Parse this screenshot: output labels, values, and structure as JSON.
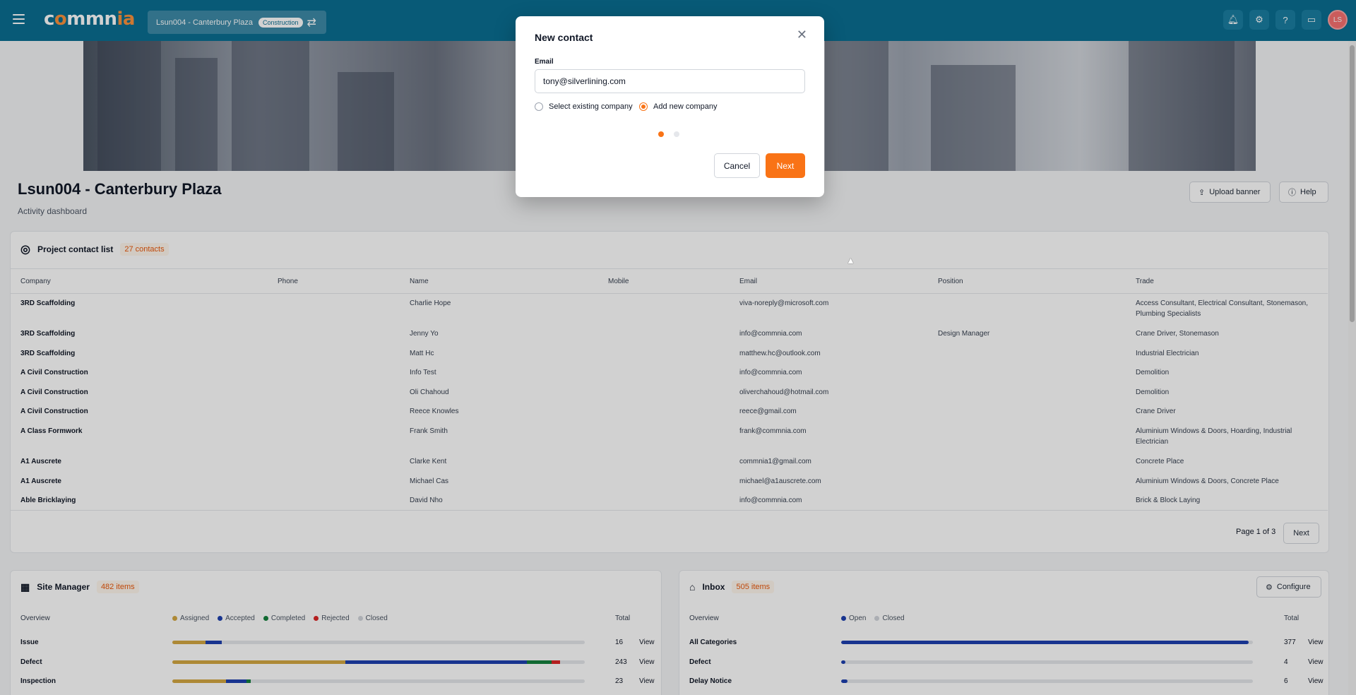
{
  "topbar": {
    "logo": "commnia",
    "project_name": "Lsun004 - Canterbury Plaza",
    "project_badge": "Construction",
    "avatar": "LS",
    "icons": [
      "bell-icon",
      "gear-icon",
      "help-icon",
      "chat-icon"
    ]
  },
  "page": {
    "title": "Lsun004 - Canterbury Plaza",
    "subtitle": "Activity dashboard",
    "upload_banner": "Upload banner",
    "help": "Help"
  },
  "contacts": {
    "title": "Project contact list",
    "count": "27 contacts",
    "headers": [
      "Company",
      "Phone",
      "Name",
      "Mobile",
      "Email",
      "Position",
      "Trade"
    ],
    "rows": [
      {
        "company": "3RD Scaffolding",
        "name": "Charlie Hope",
        "email": "viva-noreply@microsoft.com",
        "position": "",
        "trade": "Access Consultant, Electrical Consultant, Stonemason,",
        "trade2": "Plumbing Specialists"
      },
      {
        "company": "3RD Scaffolding",
        "name": "Jenny Yo",
        "email": "info@commnia.com",
        "position": "Design Manager",
        "trade": "Crane Driver, Stonemason",
        "trade2": ""
      },
      {
        "company": "3RD Scaffolding",
        "name": "Matt Hc",
        "email": "matthew.hc@outlook.com",
        "position": "",
        "trade": "Industrial Electrician",
        "trade2": ""
      },
      {
        "company": "A Civil Construction",
        "name": "Info Test",
        "email": "info@commnia.com",
        "position": "",
        "trade": "Demolition",
        "trade2": ""
      },
      {
        "company": "A Civil Construction",
        "name": "Oli Chahoud",
        "email": "oliverchahoud@hotmail.com",
        "position": "",
        "trade": "Demolition",
        "trade2": ""
      },
      {
        "company": "A Civil Construction",
        "name": "Reece Knowles",
        "email": "reece@gmail.com",
        "position": "",
        "trade": "Crane Driver",
        "trade2": ""
      },
      {
        "company": "A Class Formwork",
        "name": "Frank Smith",
        "email": "frank@commnia.com",
        "position": "",
        "trade": "Aluminium Windows & Doors, Hoarding, Industrial",
        "trade2": "Electrician"
      },
      {
        "company": "A1 Auscrete",
        "name": "Clarke Kent",
        "email": "commnia1@gmail.com",
        "position": "",
        "trade": "Concrete Place",
        "trade2": ""
      },
      {
        "company": "A1 Auscrete",
        "name": "Michael Cas",
        "email": "michael@a1auscrete.com",
        "position": "",
        "trade": "Aluminium Windows & Doors, Concrete Place",
        "trade2": ""
      },
      {
        "company": "Able Bricklaying",
        "name": "David Nho",
        "email": "info@commnia.com",
        "position": "",
        "trade": "Brick & Block Laying",
        "trade2": ""
      }
    ],
    "page_label": "Page 1 of 3",
    "next": "Next"
  },
  "site_manager": {
    "title": "Site Manager",
    "count": "482 items",
    "overview": "Overview",
    "total": "Total",
    "legend": [
      {
        "label": "Assigned",
        "color": "#d4a843"
      },
      {
        "label": "Accepted",
        "color": "#1e40af"
      },
      {
        "label": "Completed",
        "color": "#15803d"
      },
      {
        "label": "Rejected",
        "color": "#dc2626"
      },
      {
        "label": "Closed",
        "color": "#d1d5db"
      }
    ],
    "rows": [
      {
        "label": "Issue",
        "total": "16",
        "view": "View",
        "segments": [
          0.08,
          0.04,
          0.0,
          0.0
        ]
      },
      {
        "label": "Defect",
        "total": "243",
        "view": "View",
        "segments": [
          0.42,
          0.44,
          0.06,
          0.02
        ]
      },
      {
        "label": "Inspection",
        "total": "23",
        "view": "View",
        "segments": [
          0.13,
          0.05,
          0.01,
          0.0
        ]
      }
    ]
  },
  "inbox": {
    "title": "Inbox",
    "count": "505 items",
    "configure": "Configure",
    "overview": "Overview",
    "total": "Total",
    "legend": [
      {
        "label": "Open",
        "color": "#1e40af"
      },
      {
        "label": "Closed",
        "color": "#d1d5db"
      }
    ],
    "rows": [
      {
        "label": "All Categories",
        "total": "377",
        "view": "View",
        "fill": 0.99
      },
      {
        "label": "Defect",
        "total": "4",
        "view": "View",
        "fill": 0.01
      },
      {
        "label": "Delay Notice",
        "total": "6",
        "view": "View",
        "fill": 0.015
      }
    ]
  },
  "modal": {
    "title": "New contact",
    "email_label": "Email",
    "email_value": "tony@silverlining.com",
    "option_existing": "Select existing company",
    "option_new": "Add new company",
    "cancel": "Cancel",
    "next": "Next"
  }
}
